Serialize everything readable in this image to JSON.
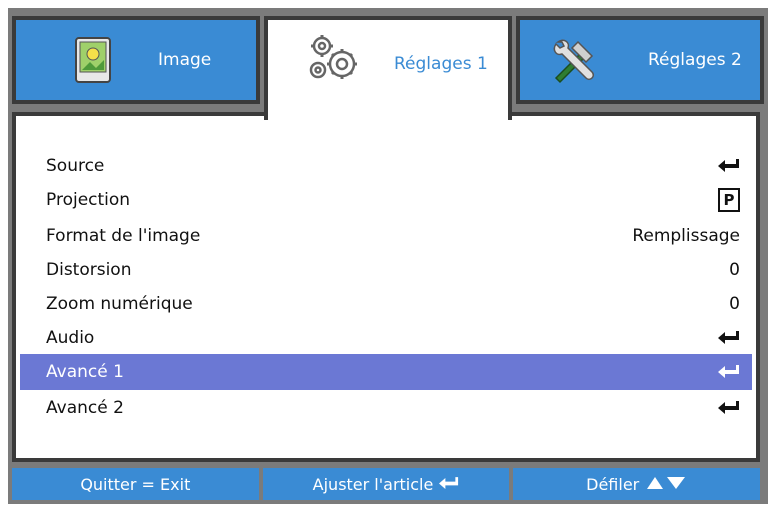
{
  "tabs": [
    {
      "label": "Image",
      "icon": "picture-icon",
      "active": false
    },
    {
      "label": "Réglages 1",
      "icon": "gears-icon",
      "active": true
    },
    {
      "label": "Réglages 2",
      "icon": "tools-icon",
      "active": false
    }
  ],
  "menu": {
    "items": [
      {
        "label": "Source",
        "value_type": "enter-icon"
      },
      {
        "label": "Projection",
        "value_type": "p-badge",
        "value": "P"
      },
      {
        "label": "Format de l'image",
        "value": "Remplissage"
      },
      {
        "label": "Distorsion",
        "value": "0"
      },
      {
        "label": "Zoom numérique",
        "value": "0"
      },
      {
        "label": "Audio",
        "value_type": "enter-icon"
      },
      {
        "label": "Avancé 1",
        "value_type": "enter-icon",
        "selected": true
      },
      {
        "label": "Avancé 2",
        "value_type": "enter-icon"
      }
    ]
  },
  "footer": {
    "exit_label": "Quitter = Exit",
    "adjust_label": "Ajuster l'article",
    "scroll_label": "Défiler"
  },
  "colors": {
    "tab_blue": "#3a8bd4",
    "selected_row": "#6b78d4",
    "frame_gray": "#7b7b7b"
  }
}
